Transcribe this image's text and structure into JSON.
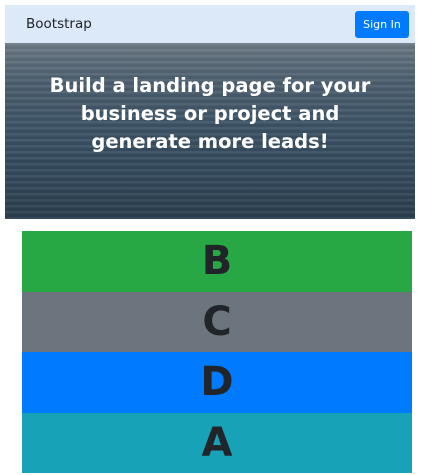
{
  "navbar": {
    "brand": "Bootstrap",
    "signin_label": "Sign In",
    "bg_color": "#dbe9f8",
    "button_color": "#007bff"
  },
  "hero": {
    "headline": "Build a landing page for your business or project and generate more leads!"
  },
  "blocks": [
    {
      "letter": "B",
      "color": "#28a745"
    },
    {
      "letter": "C",
      "color": "#6c757d"
    },
    {
      "letter": "D",
      "color": "#007bff"
    },
    {
      "letter": "A",
      "color": "#17a2b8"
    }
  ]
}
